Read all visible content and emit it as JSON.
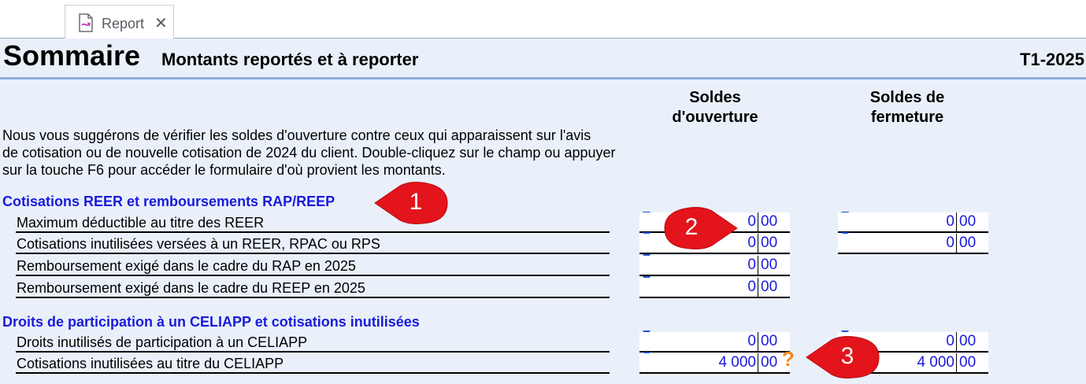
{
  "tab": {
    "label": "Report",
    "icon": "report-file-icon",
    "close_glyph": "✕"
  },
  "header": {
    "title": "Sommaire",
    "subtitle": "Montants reportés et à reporter",
    "form_code": "T1-2025"
  },
  "columns": {
    "opening_line1": "Soldes",
    "opening_line2": "d'ouverture",
    "closing_line1": "Soldes de",
    "closing_line2": "fermeture"
  },
  "intro": {
    "line1": "Nous vous suggérons de vérifier les soldes d'ouverture contre ceux qui apparaissent sur l'avis",
    "line2": "de cotisation ou de nouvelle cotisation de 2024 du client. Double-cliquez sur le champ ou appuyer",
    "line3": "sur la touche F6 pour accéder le formulaire d'où provient les montants."
  },
  "sections": [
    {
      "title": "Cotisations REER et remboursements RAP/REEP",
      "rows": [
        {
          "label": "Maximum déductible au titre des REER",
          "opening": {
            "dollars": "0",
            "cents": "00"
          },
          "closing": {
            "dollars": "0",
            "cents": "00"
          }
        },
        {
          "label": "Cotisations inutilisées versées à un REER, RPAC ou RPS",
          "opening": {
            "dollars": "0",
            "cents": "00"
          },
          "closing": {
            "dollars": "0",
            "cents": "00"
          }
        },
        {
          "label": "Remboursement exigé dans le cadre du RAP en 2025",
          "opening": {
            "dollars": "0",
            "cents": "00"
          }
        },
        {
          "label": "Remboursement exigé dans le cadre du REEP en 2025",
          "opening": {
            "dollars": "0",
            "cents": "00"
          }
        }
      ]
    },
    {
      "title": "Droits de participation à un CELIAPP et cotisations inutilisées",
      "rows": [
        {
          "label": "Droits inutilisés de participation à un CELIAPP",
          "opening": {
            "dollars": "0",
            "cents": "00"
          },
          "closing": {
            "dollars": "0",
            "cents": "00"
          }
        },
        {
          "label": "Cotisations inutilisées au titre du CELIAPP",
          "opening": {
            "dollars": "4 000",
            "cents": "00"
          },
          "closing": {
            "dollars": "4 000",
            "cents": "00"
          }
        }
      ]
    }
  ],
  "help_mark": "?",
  "callouts": [
    "1",
    "2",
    "3"
  ],
  "colors": {
    "link_blue": "#1a1adc",
    "form_bg": "#e9f0fa",
    "callout_red": "#e3141b",
    "help_orange": "#f08a1c"
  }
}
